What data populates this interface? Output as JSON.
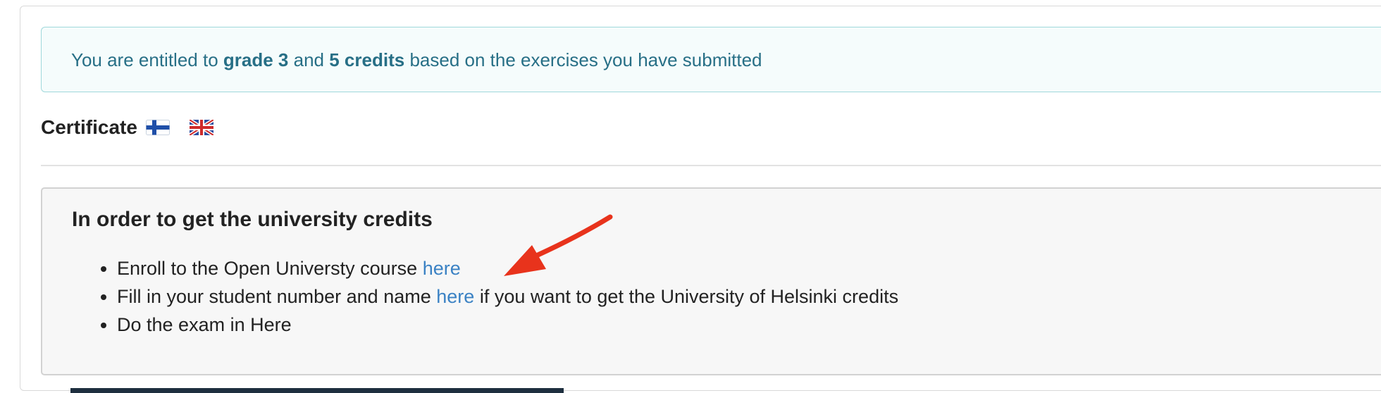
{
  "alert": {
    "prefix": "You are entitled to",
    "grade": "grade 3",
    "connector": "and",
    "credits": "5 credits",
    "suffix": "based on the exercises you have submitted",
    "color": "#276f86"
  },
  "certificate": {
    "label": "Certificate",
    "flags": [
      "finland-flag-icon",
      "uk-flag-icon"
    ]
  },
  "credits_section": {
    "title": "In order to get the university credits",
    "items": [
      {
        "text": "Enroll to the Open Universty course",
        "link": "here"
      },
      {
        "text_before": "Fill in your student number and name",
        "link": "here",
        "text_after": "if you want to get the University of Helsinki credits"
      },
      {
        "text": "Do the exam in Here"
      }
    ],
    "link_color": "#3b82c4"
  },
  "annotation": {
    "icon": "red-arrow-annotation-icon",
    "color": "#e8331c"
  }
}
